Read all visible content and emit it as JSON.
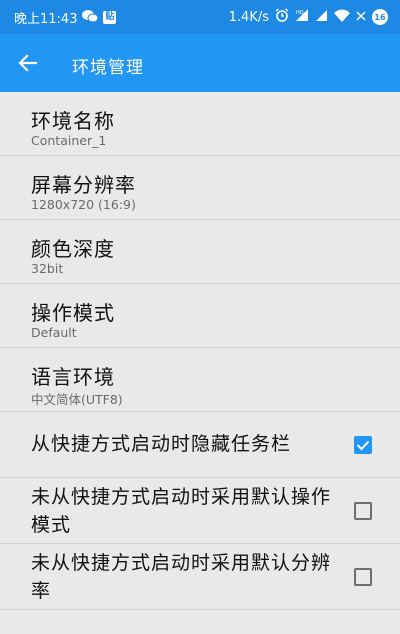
{
  "status_bar": {
    "time": "晚上11:43",
    "app_badge": "贴",
    "net_speed": "1.4K/s",
    "battery": "16",
    "icons": [
      "wechat-icon",
      "alarm-icon",
      "hd-icon",
      "signal-icon",
      "wifi-icon",
      "battery-icon"
    ]
  },
  "app_bar": {
    "title": "环境管理",
    "back_icon": "arrow-back-icon"
  },
  "preferences": [
    {
      "title": "环境名称",
      "value": "Container_1"
    },
    {
      "title": "屏幕分辨率",
      "value": "1280x720 (16:9)"
    },
    {
      "title": "颜色深度",
      "value": "32bit"
    },
    {
      "title": "操作模式",
      "value": "Default"
    },
    {
      "title": "语言环境",
      "value": "中文简体(UTF8)"
    }
  ],
  "checkbox_items": [
    {
      "label": "从快捷方式启动时隐藏任务栏",
      "checked": true
    },
    {
      "label": "未从快捷方式启动时采用默认操作模式",
      "checked": false
    },
    {
      "label": "未从快捷方式启动时采用默认分辨率",
      "checked": false
    }
  ],
  "colors": {
    "status_bar": "#1e88e5",
    "app_bar": "#2196f3",
    "background": "#e9e9e9",
    "accent": "#2196f3"
  }
}
